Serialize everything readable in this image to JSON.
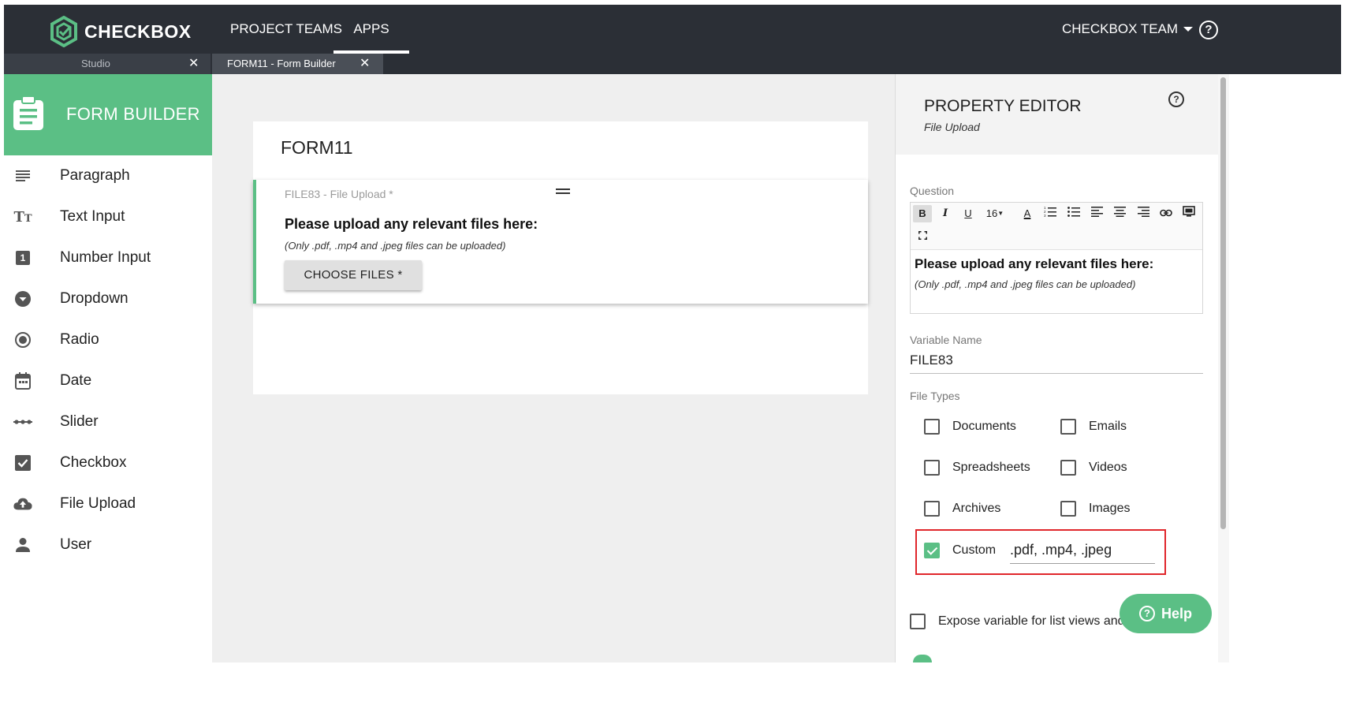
{
  "colors": {
    "topbar": "#2b2f36",
    "accent": "#5bbf85",
    "highlight_border": "#e0262b",
    "canvas_bg": "#efefef"
  },
  "topbar": {
    "logo_text": "CHECKBOX",
    "nav": [
      "PROJECT TEAMS",
      "APPS"
    ],
    "active_nav": "APPS",
    "team_menu": "CHECKBOX TEAM",
    "help_icon": "question-circle-icon"
  },
  "tabs": [
    {
      "label": "Studio",
      "active": false
    },
    {
      "label": "FORM11 - Form Builder",
      "active": true
    }
  ],
  "sidebar": {
    "title": "FORM BUILDER",
    "header_icon": "clipboard-icon",
    "items": [
      {
        "label": "Paragraph",
        "icon": "paragraph-icon"
      },
      {
        "label": "Text Input",
        "icon": "text-input-icon"
      },
      {
        "label": "Number Input",
        "icon": "number-input-icon"
      },
      {
        "label": "Dropdown",
        "icon": "dropdown-icon"
      },
      {
        "label": "Radio",
        "icon": "radio-icon"
      },
      {
        "label": "Date",
        "icon": "calendar-icon"
      },
      {
        "label": "Slider",
        "icon": "slider-icon"
      },
      {
        "label": "Checkbox",
        "icon": "checkbox-icon"
      },
      {
        "label": "File Upload",
        "icon": "cloud-upload-icon"
      },
      {
        "label": "User",
        "icon": "user-icon"
      }
    ]
  },
  "form": {
    "title": "FORM11",
    "question": {
      "meta": "FILE83 - File Upload *",
      "text": "Please upload any relevant files here:",
      "subtext": "(Only .pdf, .mp4 and .jpeg files can be uploaded)",
      "button_label": "CHOOSE FILES *"
    }
  },
  "property_editor": {
    "title": "PROPERTY EDITOR",
    "subtitle": "File Upload",
    "question_label": "Question",
    "toolbar": {
      "bold": "B",
      "italic": "I",
      "underline": "U",
      "font_size": "16",
      "icons": [
        "bold-icon",
        "italic-icon",
        "underline-icon",
        "font-size-icon",
        "font-color-icon",
        "ordered-list-icon",
        "bulleted-list-icon",
        "align-left-icon",
        "align-center-icon",
        "align-right-icon",
        "link-icon",
        "media-icon",
        "fullscreen-icon"
      ]
    },
    "question_text": "Please upload any relevant files here:",
    "question_subtext": "(Only .pdf, .mp4 and .jpeg files can be uploaded)",
    "variable_name_label": "Variable Name",
    "variable_name": "FILE83",
    "file_types_label": "File Types",
    "file_types": [
      {
        "label": "Documents",
        "checked": false
      },
      {
        "label": "Emails",
        "checked": false
      },
      {
        "label": "Spreadsheets",
        "checked": false
      },
      {
        "label": "Videos",
        "checked": false
      },
      {
        "label": "Archives",
        "checked": false
      },
      {
        "label": "Images",
        "checked": false
      }
    ],
    "custom": {
      "label": "Custom",
      "checked": true,
      "value": ".pdf, .mp4, .jpeg"
    },
    "expose_label": "Expose variable for list views and"
  },
  "help_button": {
    "label": "Help"
  }
}
